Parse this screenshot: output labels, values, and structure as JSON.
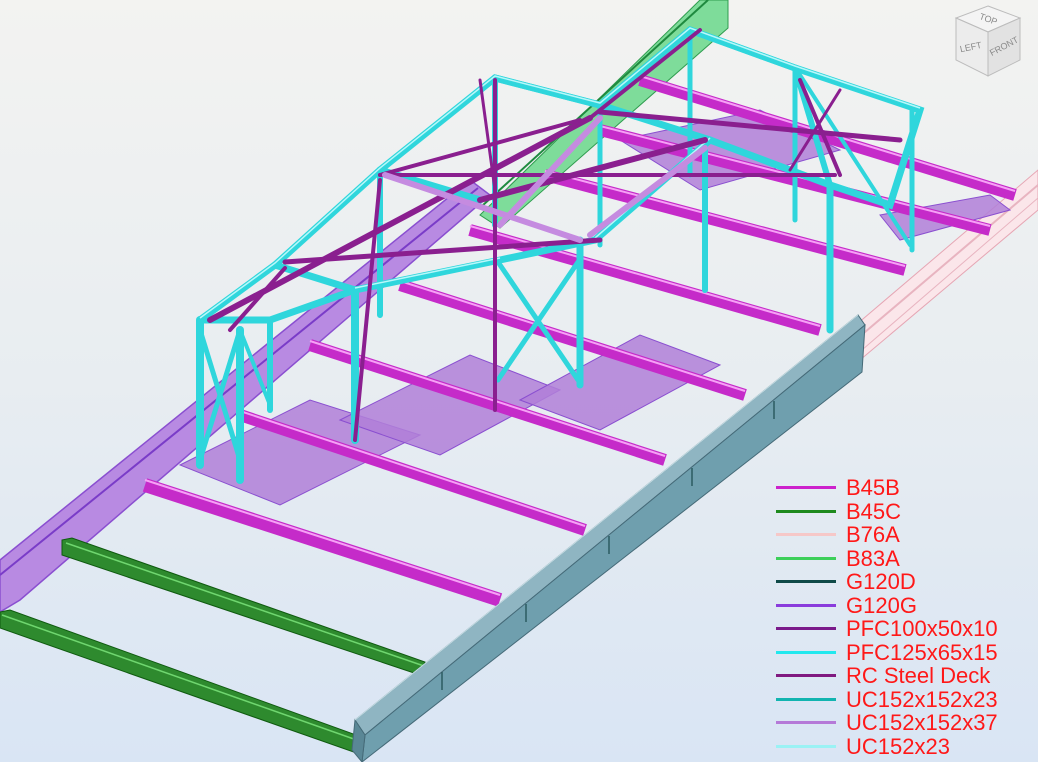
{
  "viewcube": {
    "top_label": "TOP",
    "left_label": "LEFT",
    "front_label": "FRONT"
  },
  "legend": {
    "items": [
      {
        "label": "B45B",
        "color": "#cc22cc"
      },
      {
        "label": "B45C",
        "color": "#1e8a1e"
      },
      {
        "label": "B76A",
        "color": "#f6c8c8"
      },
      {
        "label": "B83A",
        "color": "#3ccf5a"
      },
      {
        "label": "G120D",
        "color": "#0f4a48"
      },
      {
        "label": "G120G",
        "color": "#8a3cdc"
      },
      {
        "label": "PFC100x50x10",
        "color": "#7a1a8a"
      },
      {
        "label": "PFC125x65x15",
        "color": "#22e8ee"
      },
      {
        "label": "RC Steel Deck",
        "color": "#801a80"
      },
      {
        "label": "UC152x152x23",
        "color": "#12b4b0"
      },
      {
        "label": "UC152x152x37",
        "color": "#b57ad8"
      },
      {
        "label": "UC152x23",
        "color": "#9af2f4"
      }
    ]
  },
  "colors": {
    "beam_magenta": "#d43fd8",
    "beam_green": "#2e7d2e",
    "girder_grey": "#6f9fae",
    "deck_purple": "#b07fd8",
    "frame_cyan": "#2fd6dc",
    "brace_purple": "#8a1f8f",
    "side_pink": "#f4cfd4",
    "top_green": "#66cc88"
  }
}
